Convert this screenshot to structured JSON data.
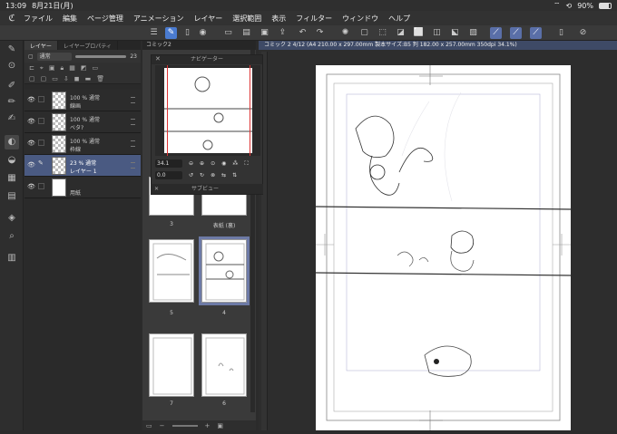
{
  "status": {
    "time": "13:09",
    "date": "8月21日(月)",
    "battery": "90%"
  },
  "menu": [
    "ファイル",
    "編集",
    "ページ管理",
    "アニメーション",
    "レイヤー",
    "選択範囲",
    "表示",
    "フィルター",
    "ウィンドウ",
    "ヘルプ"
  ],
  "layer_panel": {
    "tab_layer": "レイヤー",
    "tab_property": "レイヤープロパティ",
    "blend_mode": "通常",
    "opacity_value": "23",
    "layers": [
      {
        "opacity": "100 % 通常",
        "name": "線画",
        "thumb": "checker",
        "selected": false
      },
      {
        "opacity": "100 % 通常",
        "name": "ベタ?",
        "thumb": "checker",
        "selected": false
      },
      {
        "opacity": "100 % 通常",
        "name": "枠線",
        "thumb": "checker",
        "selected": false
      },
      {
        "opacity": "23 % 通常",
        "name": "レイヤー 1",
        "thumb": "checker",
        "selected": true
      },
      {
        "opacity": "",
        "name": "用紙",
        "thumb": "white",
        "selected": false
      }
    ]
  },
  "page_panel": {
    "tab": "コミック2"
  },
  "navigator": {
    "title": "ナビゲーター",
    "zoom": "34.1",
    "angle": "0.0",
    "sub_title": "サブビュー"
  },
  "pages": [
    {
      "label": "3",
      "selected": false
    },
    {
      "label": "表紙 (裏)",
      "selected": false
    },
    {
      "label": "5",
      "selected": false
    },
    {
      "label": "4",
      "selected": true
    },
    {
      "label": "7",
      "selected": false
    },
    {
      "label": "6",
      "selected": false
    }
  ],
  "canvas_tab": "コミック 2 4/12 (A4 210.00 x 297.00mm 製本サイズ:B5 判 182.00 x 257.00mm 350dpi 34.1%)",
  "colors": {
    "accent": "#4a7bd0",
    "selected_layer": "#4a5a82",
    "selected_page": "#6d7aa6"
  }
}
